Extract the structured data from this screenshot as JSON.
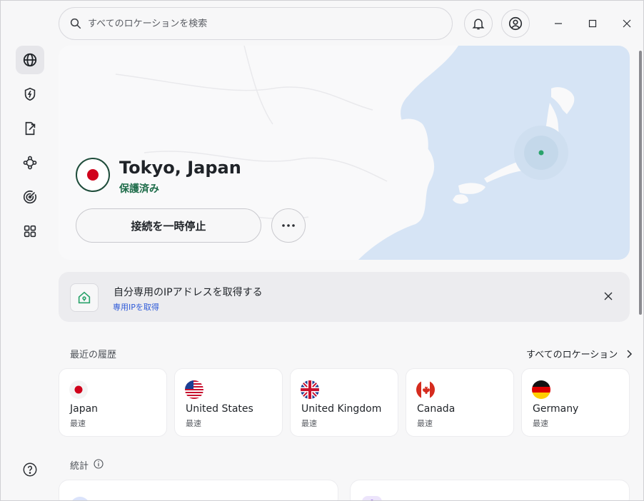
{
  "search": {
    "placeholder": "すべてのロケーションを検索"
  },
  "connection": {
    "location": "Tokyo, Japan",
    "status": "保護済み",
    "pause_label": "接続を一時停止",
    "status_color": "#1c6b48"
  },
  "banner": {
    "title": "自分専用のIPアドレスを取得する",
    "link": "専用IPを取得"
  },
  "recent": {
    "heading": "最近の履歴",
    "all_locations": "すべてのロケーション",
    "items": [
      {
        "name": "Japan",
        "sub": "最速",
        "flag": "jp"
      },
      {
        "name": "United States",
        "sub": "最速",
        "flag": "us"
      },
      {
        "name": "United Kingdom",
        "sub": "最速",
        "flag": "gb"
      },
      {
        "name": "Canada",
        "sub": "最速",
        "flag": "ca"
      },
      {
        "name": "Germany",
        "sub": "最速",
        "flag": "de"
      }
    ]
  },
  "stats": {
    "heading": "統計"
  },
  "sidebar": {
    "items": [
      {
        "icon": "globe-icon",
        "active": true
      },
      {
        "icon": "shield-bolt-icon"
      },
      {
        "icon": "split-tunnel-icon"
      },
      {
        "icon": "meshnet-icon"
      },
      {
        "icon": "radar-icon"
      },
      {
        "icon": "apps-grid-icon"
      }
    ]
  },
  "colors": {
    "accent": "#1c6b48",
    "link": "#2f5bd8",
    "map_sea": "#d6e4f5"
  }
}
